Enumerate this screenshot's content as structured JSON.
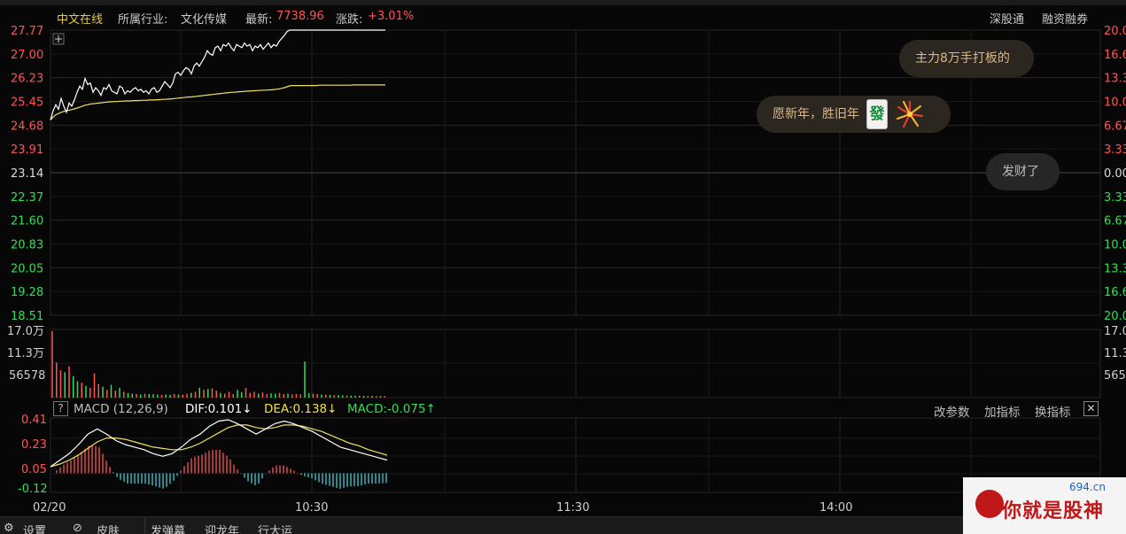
{
  "header": {
    "stock_name": "中文在线",
    "industry_label": "所属行业:",
    "industry_value": "文化传媒",
    "last_label": "最新:",
    "last_value": "7738.96",
    "change_label": "涨跌:",
    "change_value": "+3.01%",
    "link1": "深股通",
    "link2": "融资融券"
  },
  "price_axis": {
    "left_labels": [
      "27.77",
      "27.00",
      "26.23",
      "25.45",
      "24.68",
      "23.91",
      "23.14",
      "22.37",
      "21.60",
      "20.83",
      "20.05",
      "19.28",
      "18.51"
    ],
    "right_labels": [
      "20.0",
      "16.6",
      "13.3",
      "10.0",
      "6.67",
      "3.33",
      "0.00",
      "3.33",
      "6.67",
      "10.0",
      "13.3",
      "16.6",
      "20.0"
    ]
  },
  "volume_axis": {
    "left_labels": [
      "17.0万",
      "11.3万",
      "56578"
    ],
    "right_labels": [
      "17.0",
      "11.3",
      "565"
    ]
  },
  "macd": {
    "help": "?",
    "name": "MACD (12,26,9)",
    "dif": "DIF:0.101↓",
    "dea": "DEA:0.138↓",
    "macd": "MACD:-0.075↑",
    "btn_params": "改参数",
    "btn_add": "加指标",
    "btn_switch": "换指标",
    "btn_close": "✕",
    "axis_labels": [
      "0.41",
      "0.23",
      "0.05",
      "-0.12"
    ]
  },
  "time_axis": [
    "02/20",
    "10:30",
    "11:30",
    "14:00"
  ],
  "bubbles": {
    "b1": "主力8万手打板的",
    "b2": "愿新年，胜旧年",
    "b2_tile": "發",
    "b3": "发财了"
  },
  "bottom": {
    "gear_icon": "⚙",
    "settings": "设置",
    "skin_icon": "⊘",
    "skin": "皮肤",
    "tab1": "发弹幕",
    "tab2": "迎龙年",
    "tab3": "行大运"
  },
  "watermark": {
    "text": "你就是股神",
    "site": "694.cn"
  },
  "colors": {
    "up": "#ff5555",
    "down": "#33dd55",
    "avg_line": "#f0e060",
    "price_line": "#ffffff",
    "grid": "#262626",
    "macd_neg": "#3fd0d8"
  },
  "chart_data": {
    "type": "line",
    "price_series": {
      "x": [
        0,
        3,
        6,
        9,
        12,
        15,
        18,
        21,
        24,
        27,
        30,
        33,
        36,
        39,
        42,
        45,
        48,
        51,
        54,
        57,
        60,
        63,
        66,
        69,
        72,
        75,
        78,
        81,
        84,
        87,
        90,
        93,
        96,
        99,
        102,
        105,
        108,
        111,
        114,
        117,
        120,
        123,
        126,
        129,
        132,
        135,
        138,
        141,
        144,
        147,
        150,
        153,
        156,
        159,
        162,
        165,
        168,
        171,
        174,
        177,
        180,
        183,
        186,
        189,
        192,
        195,
        198,
        201,
        204,
        207,
        210,
        213,
        216,
        219,
        222,
        225,
        228,
        231,
        234,
        237,
        240,
        243,
        246,
        249,
        252,
        255,
        258,
        261,
        264,
        267,
        270,
        273,
        276,
        279,
        282,
        285,
        288,
        291,
        294,
        297,
        300,
        303,
        306,
        309,
        312,
        315,
        318,
        321,
        324,
        327,
        330,
        333,
        336,
        339,
        342,
        345,
        348,
        351,
        354,
        357,
        360,
        363,
        366,
        369,
        372,
        375,
        378
      ],
      "price": [
        24.85,
        25.15,
        25.35,
        25.2,
        25.55,
        25.3,
        25.1,
        25.4,
        25.3,
        25.5,
        25.75,
        25.95,
        25.85,
        26.2,
        26.0,
        26.05,
        25.75,
        25.9,
        25.8,
        25.65,
        25.9,
        25.85,
        26.0,
        25.8,
        25.75,
        25.7,
        25.95,
        25.9,
        25.7,
        25.8,
        25.75,
        25.85,
        25.9,
        25.8,
        25.85,
        25.75,
        25.8,
        25.7,
        25.85,
        25.9,
        25.75,
        25.8,
        25.95,
        26.1,
        26.0,
        25.9,
        26.05,
        26.35,
        26.4,
        26.3,
        26.45,
        26.55,
        26.5,
        26.35,
        26.6,
        26.7,
        26.6,
        26.75,
        26.9,
        27.1,
        27.0,
        26.95,
        27.2,
        27.25,
        27.1,
        27.3,
        27.25,
        27.35,
        27.2,
        27.1,
        27.3,
        27.25,
        27.2,
        27.35,
        27.25,
        27.3,
        27.1,
        27.25,
        27.2,
        27.3,
        27.15,
        27.25,
        27.35,
        27.2,
        27.3,
        27.25,
        27.4,
        27.5,
        27.6,
        27.72,
        27.77,
        27.77,
        27.77,
        27.77,
        27.77,
        27.77,
        27.77,
        27.77,
        27.77,
        27.77,
        27.77,
        27.77,
        27.77,
        27.77,
        27.77,
        27.77,
        27.77,
        27.77,
        27.77,
        27.77,
        27.77,
        27.77,
        27.77,
        27.77,
        27.77,
        27.77,
        27.77,
        27.77,
        27.77,
        27.77,
        27.77,
        27.77,
        27.77,
        27.77,
        27.77,
        27.77,
        27.77
      ],
      "avg": [
        24.85,
        24.95,
        25.02,
        25.06,
        25.1,
        25.13,
        25.15,
        25.17,
        25.19,
        25.21,
        25.24,
        25.27,
        25.3,
        25.33,
        25.35,
        25.37,
        25.38,
        25.39,
        25.4,
        25.41,
        25.42,
        25.43,
        25.44,
        25.44,
        25.45,
        25.45,
        25.46,
        25.46,
        25.47,
        25.47,
        25.47,
        25.48,
        25.48,
        25.48,
        25.49,
        25.49,
        25.49,
        25.5,
        25.5,
        25.5,
        25.51,
        25.51,
        25.52,
        25.52,
        25.53,
        25.53,
        25.54,
        25.55,
        25.56,
        25.57,
        25.58,
        25.59,
        25.6,
        25.6,
        25.61,
        25.62,
        25.63,
        25.64,
        25.65,
        25.66,
        25.67,
        25.68,
        25.69,
        25.7,
        25.71,
        25.72,
        25.73,
        25.74,
        25.75,
        25.75,
        25.76,
        25.77,
        25.77,
        25.78,
        25.79,
        25.79,
        25.8,
        25.8,
        25.81,
        25.81,
        25.82,
        25.82,
        25.83,
        25.83,
        25.84,
        25.85,
        25.86,
        25.88,
        25.9,
        25.93,
        25.96,
        25.97,
        25.97,
        25.97,
        25.97,
        25.97,
        25.97,
        25.97,
        25.97,
        25.97,
        25.97,
        25.98,
        25.98,
        25.98,
        25.98,
        25.98,
        25.98,
        25.98,
        25.98,
        25.98,
        25.98,
        25.98,
        25.98,
        25.98,
        25.99,
        25.99,
        25.99,
        25.99,
        25.99,
        25.99,
        25.99,
        25.99,
        25.99,
        25.99,
        25.99,
        25.99,
        25.99
      ],
      "ylim": [
        18.51,
        27.77
      ]
    },
    "volume": {
      "values": [
        170000,
        90000,
        70000,
        65000,
        80000,
        55000,
        42000,
        38000,
        30000,
        25000,
        62000,
        35000,
        28000,
        20000,
        33000,
        18000,
        25000,
        15000,
        12000,
        10000,
        9000,
        8000,
        10000,
        9000,
        8500,
        8000,
        7000,
        8000,
        7000,
        9000,
        8000,
        7500,
        10000,
        12000,
        15000,
        25000,
        20000,
        22000,
        24000,
        18000,
        12000,
        10000,
        15000,
        9000,
        20000,
        14000,
        25000,
        12000,
        15000,
        10000,
        13000,
        9000,
        11000,
        10000,
        12000,
        9000,
        10000,
        8000,
        9000,
        8500,
        92000,
        11000,
        10000,
        9000,
        8000,
        7500,
        7000,
        6500,
        6000,
        6000,
        5500,
        5000,
        5000,
        5000,
        4500,
        4500,
        4500,
        4000,
        4000,
        4000
      ],
      "ylim": [
        0,
        170000
      ]
    },
    "macd_series": {
      "dif": [
        0.05,
        0.1,
        0.15,
        0.22,
        0.3,
        0.34,
        0.3,
        0.25,
        0.22,
        0.2,
        0.18,
        0.15,
        0.13,
        0.15,
        0.2,
        0.26,
        0.3,
        0.36,
        0.4,
        0.41,
        0.38,
        0.34,
        0.3,
        0.34,
        0.38,
        0.4,
        0.38,
        0.35,
        0.32,
        0.28,
        0.24,
        0.2,
        0.18,
        0.16,
        0.14,
        0.12,
        0.101
      ],
      "dea": [
        0.05,
        0.07,
        0.1,
        0.14,
        0.19,
        0.24,
        0.27,
        0.27,
        0.26,
        0.24,
        0.22,
        0.2,
        0.19,
        0.18,
        0.18,
        0.2,
        0.23,
        0.27,
        0.31,
        0.35,
        0.37,
        0.37,
        0.35,
        0.34,
        0.35,
        0.37,
        0.37,
        0.36,
        0.34,
        0.32,
        0.29,
        0.26,
        0.23,
        0.21,
        0.18,
        0.16,
        0.138
      ],
      "ylim": [
        -0.12,
        0.41
      ]
    }
  }
}
